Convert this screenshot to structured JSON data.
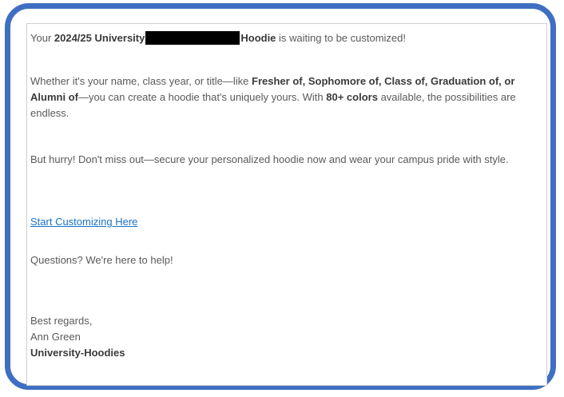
{
  "email": {
    "p1": {
      "prefix": "Your ",
      "bold_product": "2024/25 University",
      "bold_hoodie": "Hoodie",
      "suffix": " is waiting to be customized!"
    },
    "p2": {
      "text_a": "Whether it's your name, class year, or title—like ",
      "bold_titles": "Fresher of, Sophomore of, Class of, Graduation of, or Alumni of",
      "text_b": "—you can create a hoodie that's uniquely yours. With ",
      "bold_colors": "80+ colors",
      "text_c": " available, the possibilities are endless."
    },
    "p3": "But hurry! Don't miss out—secure your personalized hoodie now and wear your campus pride with style.",
    "cta_link": "Start Customizing Here",
    "p5": "Questions? We're here to help!",
    "signature": {
      "closing": "Best regards,",
      "name": "Ann Green",
      "company": "University-Hoodies"
    }
  },
  "colors": {
    "frame_border": "#3f6fc3",
    "link": "#1a73c9",
    "body_text": "#5a5a5a"
  }
}
